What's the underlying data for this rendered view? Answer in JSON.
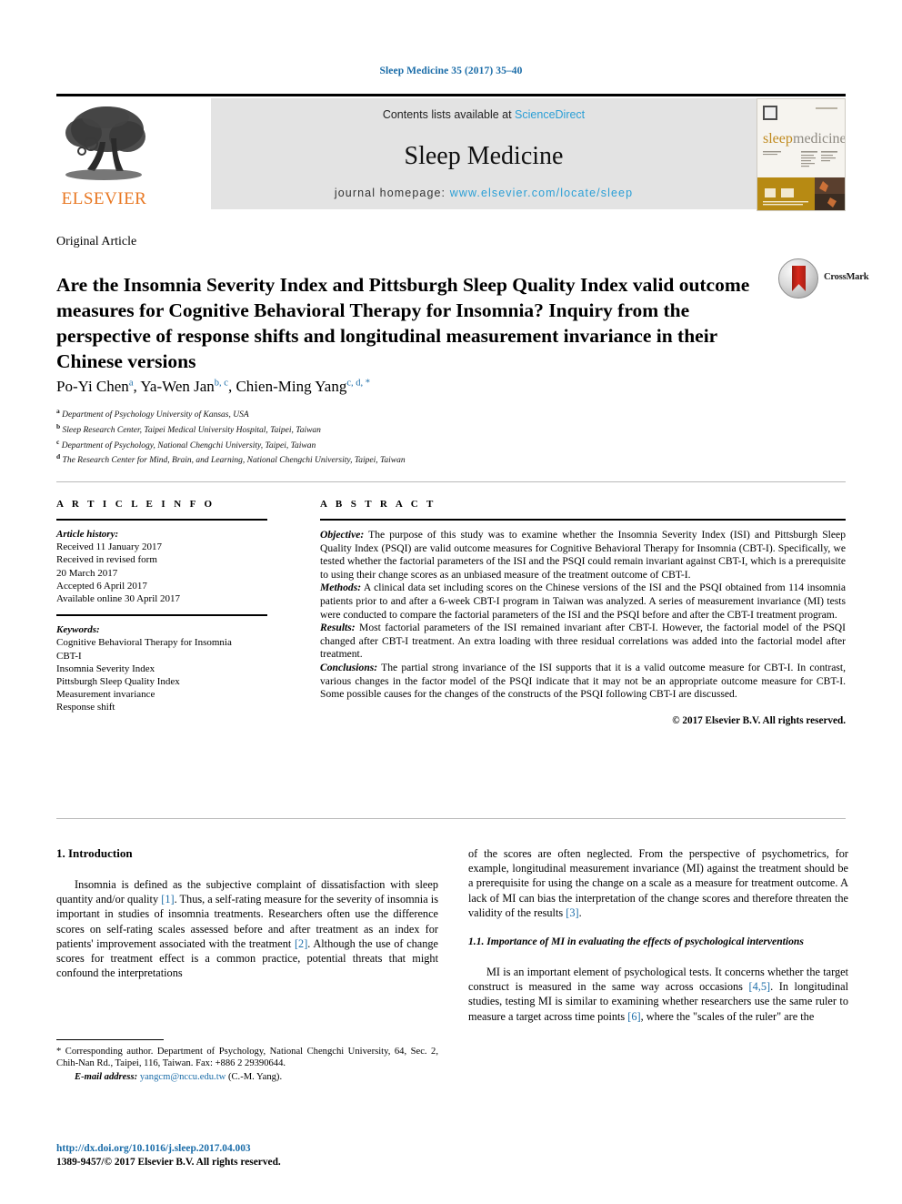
{
  "running_head": "Sleep Medicine 35 (2017) 35–40",
  "masthead": {
    "contents_prefix": "Contents lists available at ",
    "contents_link": "ScienceDirect",
    "journal_name": "Sleep Medicine",
    "homepage_prefix": "journal homepage: ",
    "homepage_url": "www.elsevier.com/locate/sleep",
    "publisher_wordmark": "ELSEVIER",
    "cover_wordmark_a": "sleep",
    "cover_wordmark_b": "medicine"
  },
  "article": {
    "type": "Original Article",
    "title": "Are the Insomnia Severity Index and Pittsburgh Sleep Quality Index valid outcome measures for Cognitive Behavioral Therapy for Insomnia? Inquiry from the perspective of response shifts and longitudinal measurement invariance in their Chinese versions",
    "crossmark_label": "CrossMark",
    "authors": [
      {
        "name": "Po-Yi Chen",
        "marks": "a"
      },
      {
        "name": "Ya-Wen Jan",
        "marks": "b, c"
      },
      {
        "name": "Chien-Ming Yang",
        "marks": "c, d, *"
      }
    ],
    "affiliations": [
      {
        "mark": "a",
        "text": "Department of Psychology University of Kansas, USA"
      },
      {
        "mark": "b",
        "text": "Sleep Research Center, Taipei Medical University Hospital, Taipei, Taiwan"
      },
      {
        "mark": "c",
        "text": "Department of Psychology, National Chengchi University, Taipei, Taiwan"
      },
      {
        "mark": "d",
        "text": "The Research Center for Mind, Brain, and Learning, National Chengchi University, Taipei, Taiwan"
      }
    ]
  },
  "article_info": {
    "heading": "A R T I C L E   I N F O",
    "history_label": "Article history:",
    "history": [
      "Received 11 January 2017",
      "Received in revised form",
      "20 March 2017",
      "Accepted 6 April 2017",
      "Available online 30 April 2017"
    ],
    "keywords_label": "Keywords:",
    "keywords": [
      "Cognitive Behavioral Therapy for Insomnia",
      "CBT-I",
      "Insomnia Severity Index",
      "Pittsburgh Sleep Quality Index",
      "Measurement invariance",
      "Response shift"
    ]
  },
  "abstract": {
    "heading": "A B S T R A C T",
    "objective_label": "Objective:",
    "objective_text": " The purpose of this study was to examine whether the Insomnia Severity Index (ISI) and Pittsburgh Sleep Quality Index (PSQI) are valid outcome measures for Cognitive Behavioral Therapy for Insomnia (CBT-I). Specifically, we tested whether the factorial parameters of the ISI and the PSQI could remain invariant against CBT-I, which is a prerequisite to using their change scores as an unbiased measure of the treatment outcome of CBT-I.",
    "methods_label": "Methods:",
    "methods_text": " A clinical data set including scores on the Chinese versions of the ISI and the PSQI obtained from 114 insomnia patients prior to and after a 6-week CBT-I program in Taiwan was analyzed. A series of measurement invariance (MI) tests were conducted to compare the factorial parameters of the ISI and the PSQI before and after the CBT-I treatment program.",
    "results_label": "Results:",
    "results_text": " Most factorial parameters of the ISI remained invariant after CBT-I. However, the factorial model of the PSQI changed after CBT-I treatment. An extra loading with three residual correlations was added into the factorial model after treatment.",
    "conclusions_label": "Conclusions:",
    "conclusions_text": " The partial strong invariance of the ISI supports that it is a valid outcome measure for CBT-I. In contrast, various changes in the factor model of the PSQI indicate that it may not be an appropriate outcome measure for CBT-I. Some possible causes for the changes of the constructs of the PSQI following CBT-I are discussed.",
    "copyright": "© 2017 Elsevier B.V. All rights reserved."
  },
  "body": {
    "intro_heading": "1. Introduction",
    "intro_p1_a": "Insomnia is defined as the subjective complaint of dissatisfaction with sleep quantity and/or quality ",
    "intro_ref1": "[1]",
    "intro_p1_b": ". Thus, a self-rating measure for the severity of insomnia is important in studies of insomnia treatments. Researchers often use the difference scores on self-rating scales assessed before and after treatment as an index for patients' improvement associated with the treatment ",
    "intro_ref2": "[2]",
    "intro_p1_c": ". Although the use of change scores for treatment effect is a common practice, potential threats that might confound the interpretations",
    "intro_p1_cont": "of the scores are often neglected. From the perspective of psychometrics, for example, longitudinal measurement invariance (MI) against the treatment should be a prerequisite for using the change on a scale as a measure for treatment outcome. A lack of MI can bias the interpretation of the change scores and therefore threaten the validity of the results ",
    "intro_ref3": "[3]",
    "intro_p1_end": ".",
    "sub_heading": "1.1. Importance of MI in evaluating the effects of psychological interventions",
    "sub_p1_a": "MI is an important element of psychological tests. It concerns whether the target construct is measured in the same way across occasions ",
    "sub_ref45": "[4,5]",
    "sub_p1_b": ". In longitudinal studies, testing MI is similar to examining whether researchers use the same ruler to measure a target across time points ",
    "sub_ref6": "[6]",
    "sub_p1_c": ", where the \"scales of the ruler\" are the"
  },
  "footer": {
    "corresponding_mark": "*",
    "corresponding_text": " Corresponding author. Department of Psychology, National Chengchi University, 64, Sec. 2, Chih-Nan Rd., Taipei, 116, Taiwan. Fax: +886 2 29390644.",
    "email_label": "E-mail address:",
    "email": "yangcm@nccu.edu.tw",
    "email_owner": " (C.-M. Yang).",
    "doi": "http://dx.doi.org/10.1016/j.sleep.2017.04.003",
    "issn_line": "1389-9457/© 2017 Elsevier B.V. All rights reserved."
  },
  "colors": {
    "link": "#1a6ca8",
    "science_direct": "#2a9fd6",
    "elsevier_orange": "#e87722",
    "band_gray": "#e3e3e3",
    "crossmark_red": "#d8291c"
  }
}
